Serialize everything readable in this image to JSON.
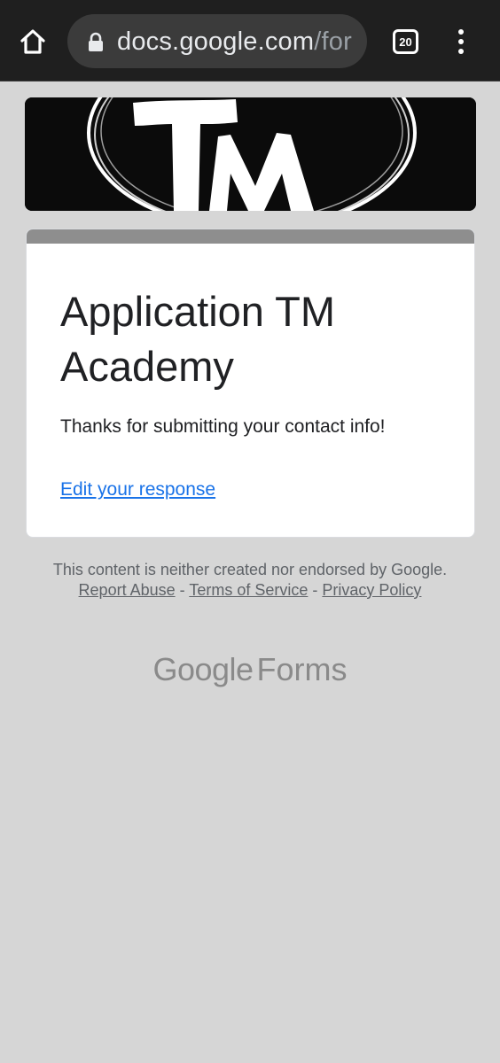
{
  "browser": {
    "url_host": "docs.google.com",
    "url_path": "/for",
    "tab_count": "20"
  },
  "form": {
    "title": "Application TM Academy",
    "confirmation_message": "Thanks for submitting your contact info!",
    "edit_link": "Edit your response"
  },
  "footer": {
    "disclaimer": "This content is neither created nor endorsed by Google.",
    "report_abuse": "Report Abuse",
    "separator": "-",
    "terms": "Terms of Service",
    "privacy": "Privacy Policy",
    "brand_google": "Google",
    "brand_forms": "Forms"
  },
  "icons": {
    "home": "home-icon",
    "lock": "lock-icon",
    "tabs": "tab-switcher-icon",
    "menu": "more-vert-icon"
  },
  "colors": {
    "toolbar_bg": "#1f1f1f",
    "page_bg": "#d6d6d6",
    "link_blue": "#1a73e8",
    "accent_gray": "#8e8e8e"
  }
}
